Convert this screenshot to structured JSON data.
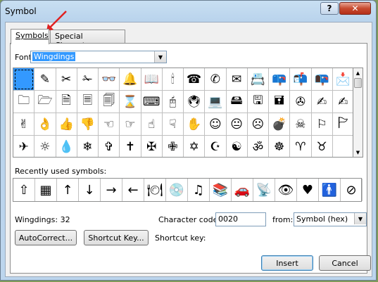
{
  "window": {
    "title": "Symbol",
    "help": "?",
    "close": "✕"
  },
  "tabs": {
    "symbols": "Symbols",
    "special": "Special Characters"
  },
  "font": {
    "label": "Font:",
    "value": "Wingdings"
  },
  "symbols": [
    "",
    "✎",
    "✂",
    "✁",
    "👓",
    "🔔",
    "📖",
    "🕯",
    "☎",
    "✆",
    "✉",
    "📇",
    "📪",
    "📬",
    "📭",
    "📩",
    "🗀",
    "🗁",
    "🗎",
    "🗏",
    "🗐",
    "⌛",
    "⌨",
    "🖰",
    "🖲",
    "💻",
    "🖴",
    "🖫",
    "🖬",
    "✇",
    "✍",
    "✍",
    "✌",
    "👌",
    "👍",
    "👎",
    "☜",
    "☞",
    "☝",
    "☟",
    "✋",
    "☺",
    "😐",
    "☹",
    "💣",
    "☠",
    "⚐",
    "🏱",
    "✈",
    "☼",
    "💧",
    "❄",
    "✞",
    "✝",
    "✠",
    "✙",
    "✡",
    "☪",
    "☯",
    "ॐ",
    "☸",
    "♈",
    "♉",
    ""
  ],
  "recent": {
    "label": "Recently used symbols:",
    "items": [
      "⇧",
      "▦",
      "↑",
      "↓",
      "→",
      "←",
      "🍽",
      "💿",
      "♫",
      "📚",
      "🚗",
      "📡",
      "👁",
      "♥",
      "🚹",
      "⊘"
    ]
  },
  "status": {
    "name": "Wingdings: 32",
    "char_code_label": "Character code:",
    "char_code": "0020",
    "from_label": "from:",
    "from_value": "Symbol (hex)",
    "shortcut_label": "Shortcut key:"
  },
  "buttons": {
    "autocorrect": "AutoCorrect...",
    "shortcut": "Shortcut Key...",
    "insert": "Insert",
    "cancel": "Cancel"
  },
  "colors": {
    "selection": "#3399ff",
    "arrow": "#e02020"
  }
}
